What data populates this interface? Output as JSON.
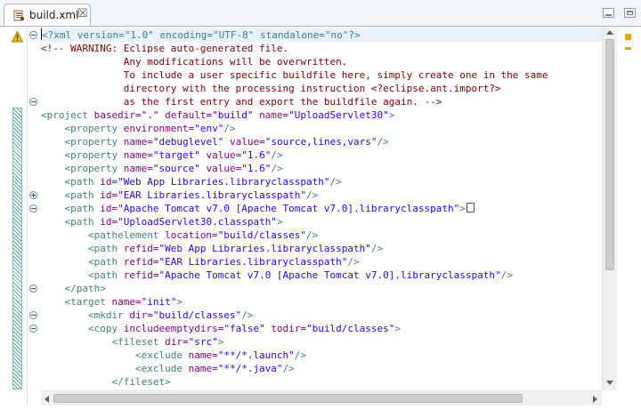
{
  "tab": {
    "title": "build.xml",
    "close_glyph": "☒",
    "icon": "ant-file-icon"
  },
  "window": {
    "minimize_icon": "minimize-icon",
    "maximize_icon": "maximize-icon"
  },
  "markers": {
    "warning_icon": "warning-icon",
    "overview_warning_icon": "warning-marker-icon"
  },
  "colors": {
    "tag": "#3f7f7f",
    "attribute": "#7f007f",
    "value": "#2a00ff",
    "comment": "#7f0000",
    "current_line": "#e8f2fe",
    "warning": "#e9a800"
  },
  "lines": [
    [
      [
        "pi",
        "<?xml version=\"1.0\" encoding=\"UTF-8\" standalone=\"no\"?>"
      ]
    ],
    [
      [
        "com",
        "<!-- WARNING: Eclipse auto-generated file."
      ]
    ],
    [
      [
        "com",
        "              Any modifications will be overwritten."
      ]
    ],
    [
      [
        "com",
        "              To include a user specific buildfile here, simply create one in the same"
      ]
    ],
    [
      [
        "com",
        "              directory with the processing instruction <?eclipse.ant.import?>"
      ]
    ],
    [
      [
        "com",
        "              as the first entry and export the buildfile again. -->"
      ]
    ],
    [
      [
        "tag",
        "<project "
      ],
      [
        "attr",
        "basedir="
      ],
      [
        "val",
        "\".\""
      ],
      [
        "sp",
        " "
      ],
      [
        "attr",
        "default="
      ],
      [
        "val",
        "\"build\""
      ],
      [
        "sp",
        " "
      ],
      [
        "attr",
        "name="
      ],
      [
        "val",
        "\"UploadServlet30\""
      ],
      [
        "tag",
        ">"
      ]
    ],
    [
      [
        "sp",
        "    "
      ],
      [
        "tag",
        "<property "
      ],
      [
        "attr",
        "environment="
      ],
      [
        "val",
        "\"env\""
      ],
      [
        "tag",
        "/>"
      ]
    ],
    [
      [
        "sp",
        "    "
      ],
      [
        "tag",
        "<property "
      ],
      [
        "attr",
        "name="
      ],
      [
        "val",
        "\"debuglevel\""
      ],
      [
        "sp",
        " "
      ],
      [
        "attr",
        "value="
      ],
      [
        "val",
        "\"source,lines,vars\""
      ],
      [
        "tag",
        "/>"
      ]
    ],
    [
      [
        "sp",
        "    "
      ],
      [
        "tag",
        "<property "
      ],
      [
        "attr",
        "name="
      ],
      [
        "val",
        "\"target\""
      ],
      [
        "sp",
        " "
      ],
      [
        "attr",
        "value="
      ],
      [
        "val",
        "\"1.6\""
      ],
      [
        "tag",
        "/>"
      ]
    ],
    [
      [
        "sp",
        "    "
      ],
      [
        "tag",
        "<property "
      ],
      [
        "attr",
        "name="
      ],
      [
        "val",
        "\"source\""
      ],
      [
        "sp",
        " "
      ],
      [
        "attr",
        "value="
      ],
      [
        "val",
        "\"1.6\""
      ],
      [
        "tag",
        "/>"
      ]
    ],
    [
      [
        "sp",
        "    "
      ],
      [
        "tag",
        "<path "
      ],
      [
        "attr",
        "id="
      ],
      [
        "val",
        "\"Web App Libraries.libraryclasspath\""
      ],
      [
        "tag",
        "/>"
      ]
    ],
    [
      [
        "sp",
        "    "
      ],
      [
        "tag",
        "<path "
      ],
      [
        "attr",
        "id="
      ],
      [
        "val",
        "\"EAR Libraries.libraryclasspath\""
      ],
      [
        "tag",
        "/>"
      ]
    ],
    [
      [
        "sp",
        "    "
      ],
      [
        "tag",
        "<path "
      ],
      [
        "attr",
        "id="
      ],
      [
        "val",
        "\"Apache Tomcat v7.0 [Apache Tomcat v7.0].libraryclasspath\""
      ],
      [
        "tag",
        ">"
      ]
    ],
    [
      [
        "sp",
        "    "
      ],
      [
        "tag",
        "<path "
      ],
      [
        "attr",
        "id="
      ],
      [
        "val",
        "\"UploadServlet30.classpath\""
      ],
      [
        "tag",
        ">"
      ]
    ],
    [
      [
        "sp",
        "        "
      ],
      [
        "tag",
        "<pathelement "
      ],
      [
        "attr",
        "location="
      ],
      [
        "val",
        "\"build/classes\""
      ],
      [
        "tag",
        "/>"
      ]
    ],
    [
      [
        "sp",
        "        "
      ],
      [
        "tag",
        "<path "
      ],
      [
        "attr",
        "refid="
      ],
      [
        "val",
        "\"Web App Libraries.libraryclasspath\""
      ],
      [
        "tag",
        "/>"
      ]
    ],
    [
      [
        "sp",
        "        "
      ],
      [
        "tag",
        "<path "
      ],
      [
        "attr",
        "refid="
      ],
      [
        "val",
        "\"EAR Libraries.libraryclasspath\""
      ],
      [
        "tag",
        "/>"
      ]
    ],
    [
      [
        "sp",
        "        "
      ],
      [
        "tag",
        "<path "
      ],
      [
        "attr",
        "refid="
      ],
      [
        "val",
        "\"Apache Tomcat v7.0 [Apache Tomcat v7.0].libraryclasspath\""
      ],
      [
        "tag",
        "/>"
      ]
    ],
    [
      [
        "sp",
        "    "
      ],
      [
        "tag",
        "</path>"
      ]
    ],
    [
      [
        "sp",
        "    "
      ],
      [
        "tag",
        "<target "
      ],
      [
        "attr",
        "name="
      ],
      [
        "val",
        "\"init\""
      ],
      [
        "tag",
        ">"
      ]
    ],
    [
      [
        "sp",
        "        "
      ],
      [
        "tag",
        "<mkdir "
      ],
      [
        "attr",
        "dir="
      ],
      [
        "val",
        "\"build/classes\""
      ],
      [
        "tag",
        "/>"
      ]
    ],
    [
      [
        "sp",
        "        "
      ],
      [
        "tag",
        "<copy "
      ],
      [
        "attr",
        "includeemptydirs="
      ],
      [
        "val",
        "\"false\""
      ],
      [
        "sp",
        " "
      ],
      [
        "attr",
        "todir="
      ],
      [
        "val",
        "\"build/classes\""
      ],
      [
        "tag",
        ">"
      ]
    ],
    [
      [
        "sp",
        "            "
      ],
      [
        "tag",
        "<fileset "
      ],
      [
        "attr",
        "dir="
      ],
      [
        "val",
        "\"src\""
      ],
      [
        "tag",
        ">"
      ]
    ],
    [
      [
        "sp",
        "                "
      ],
      [
        "tag",
        "<exclude "
      ],
      [
        "attr",
        "name="
      ],
      [
        "val",
        "\"**/*.launch\""
      ],
      [
        "tag",
        "/>"
      ]
    ],
    [
      [
        "sp",
        "                "
      ],
      [
        "tag",
        "<exclude "
      ],
      [
        "attr",
        "name="
      ],
      [
        "val",
        "\"**/*.java\""
      ],
      [
        "tag",
        "/>"
      ]
    ],
    [
      [
        "sp",
        "            "
      ],
      [
        "tag",
        "</fileset>"
      ]
    ]
  ],
  "folds": [
    {
      "line": 1,
      "state": "expanded"
    },
    {
      "line": 6,
      "state": "expanded"
    },
    {
      "line": 13,
      "state": "collapsed"
    },
    {
      "line": 14,
      "state": "expanded"
    },
    {
      "line": 20,
      "state": "expanded"
    },
    {
      "line": 22,
      "state": "expanded"
    },
    {
      "line": 23,
      "state": "expanded"
    }
  ]
}
